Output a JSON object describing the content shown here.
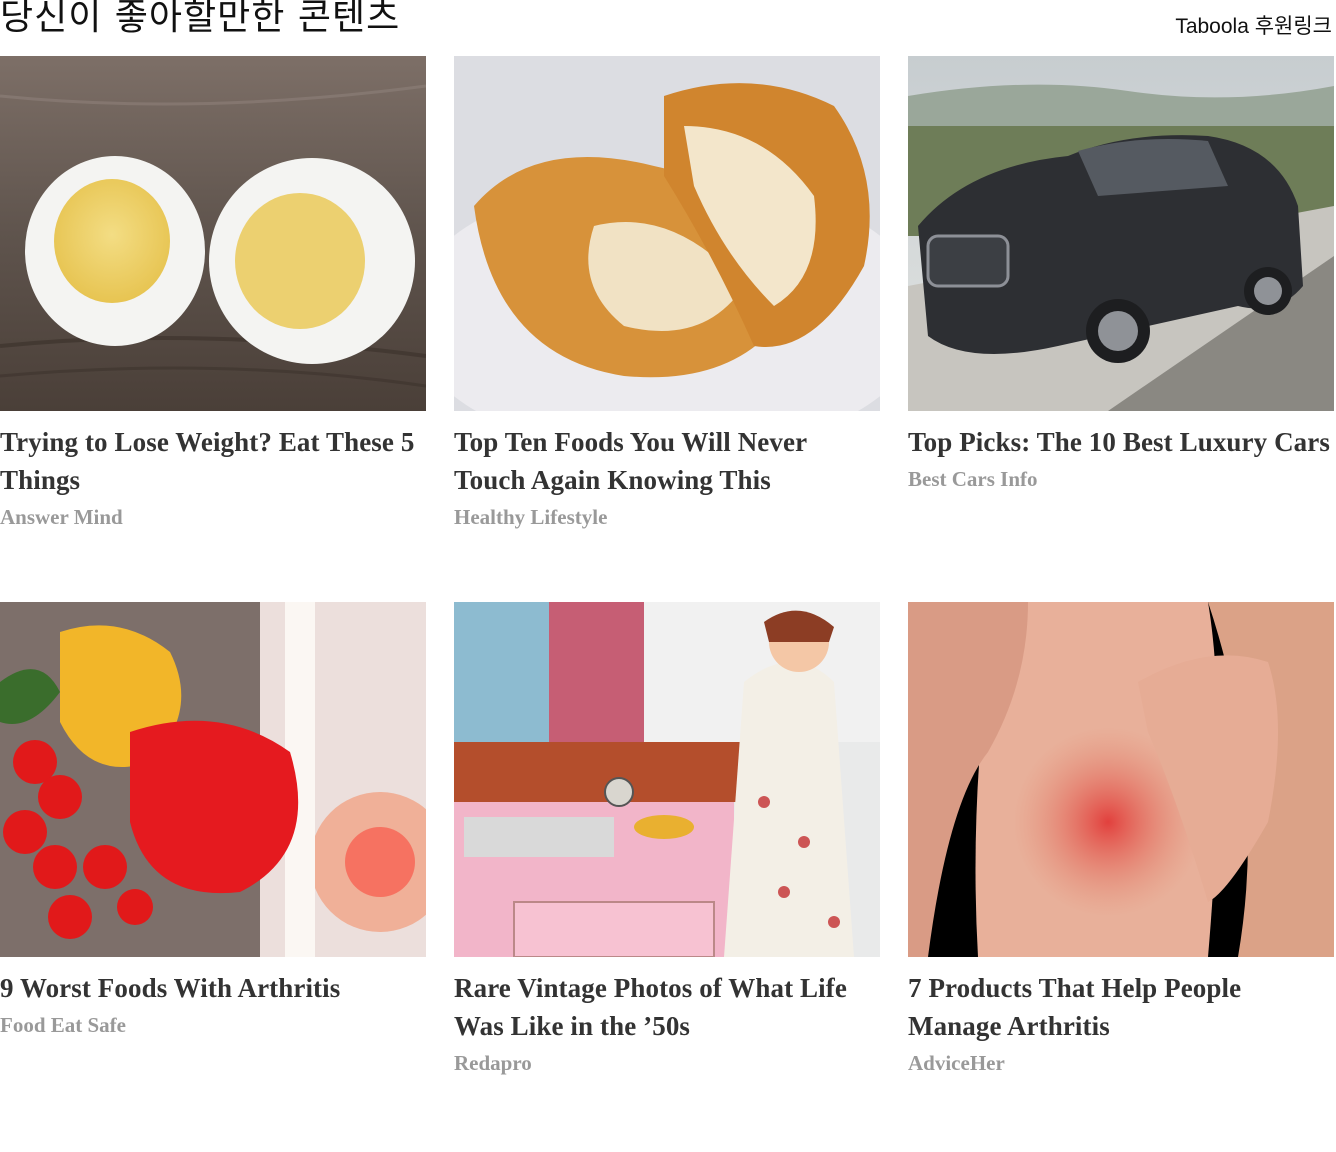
{
  "header": {
    "title": "당신이 좋아할만한 콘텐츠",
    "sponsor_label": "Taboola 후원링크"
  },
  "cards": [
    {
      "title": "Trying to Lose Weight? Eat These 5 Things",
      "source": "Answer Mind",
      "image": "boiled-eggs-image"
    },
    {
      "title": "Top Ten Foods You Will Never Touch Again Knowing This",
      "source": "Healthy Lifestyle",
      "image": "fried-chicken-nugget-image"
    },
    {
      "title": "Top Picks: The 10 Best Luxury Cars",
      "source": "Best Cars Info",
      "image": "luxury-car-image"
    },
    {
      "title": "9 Worst Foods With Arthritis",
      "source": "Food Eat Safe",
      "image": "vegetables-skeleton-image"
    },
    {
      "title": "Rare Vintage Photos of What Life Was Like in the ’50s",
      "source": "Redapro",
      "image": "vintage-kitchen-image"
    },
    {
      "title": "7 Products That Help People Manage Arthritis",
      "source": "AdviceHer",
      "image": "knee-arthritis-image"
    }
  ]
}
